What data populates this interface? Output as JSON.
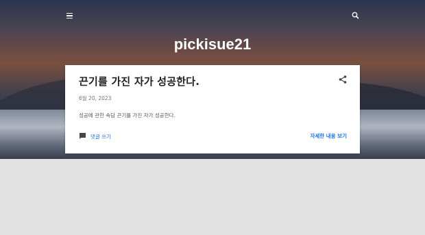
{
  "header": {
    "site_title": "pickisue21",
    "menu_icon": "hamburger-menu-icon",
    "search_icon": "search-icon"
  },
  "post": {
    "title": "끈기를 가진 자가 성공한다.",
    "date": "6월 20, 2023",
    "snippet": "성공에 관한 속담 끈기를 가진 자가 성공한다.",
    "share_icon": "share-icon",
    "comment_icon": "comment-icon",
    "comment_label": "댓글 쓰기",
    "read_more_label": "자세한 내용 보기"
  },
  "colors": {
    "link": "#1a73e8",
    "card_bg": "#ffffff",
    "page_bg": "#e2e2e2"
  }
}
